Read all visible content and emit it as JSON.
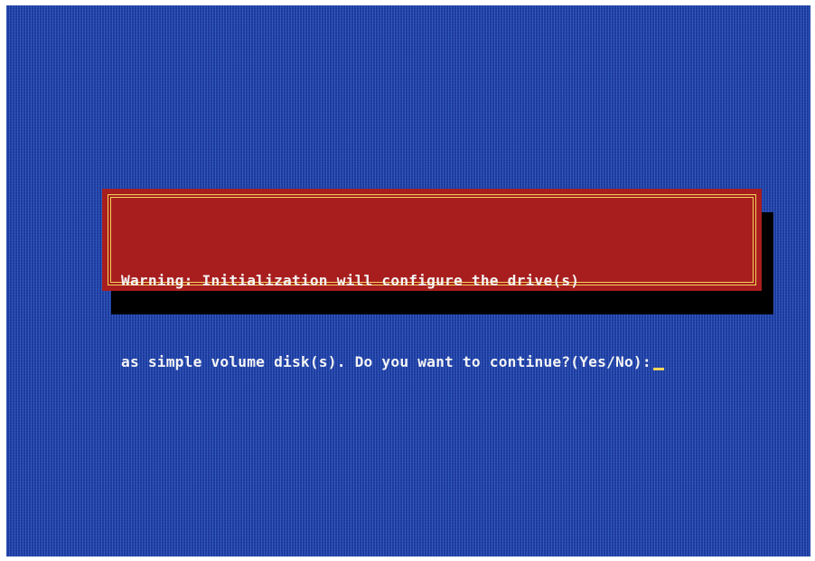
{
  "screen": {
    "background_color": "#1f3fa3"
  },
  "dialog": {
    "type": "warning",
    "background_color": "#a81e1e",
    "border_color": "#f2d35a",
    "text_color": "#f4f4f4",
    "line1": "Warning: Initialization will configure the drive(s)",
    "line2": "as simple volume disk(s). Do you want to continue?(Yes/No):",
    "input_value": "",
    "cursor": "_"
  }
}
